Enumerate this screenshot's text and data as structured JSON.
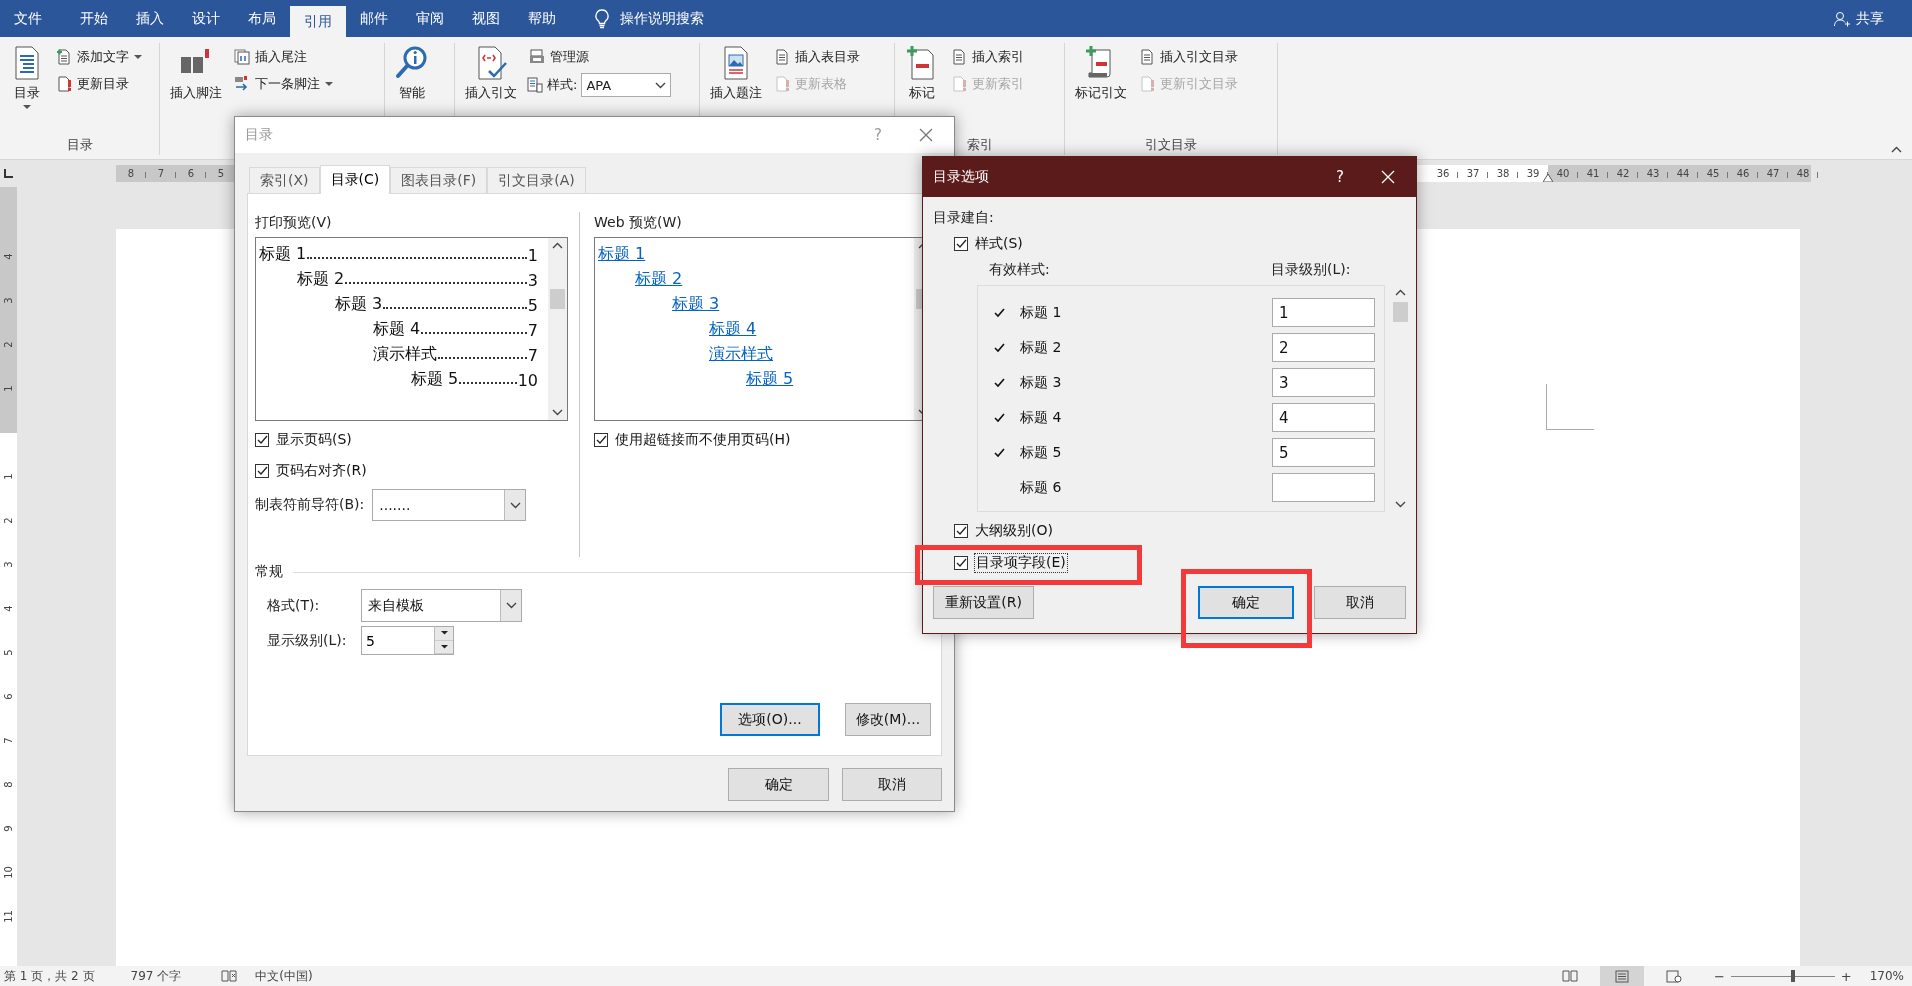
{
  "menu_tabs": [
    {
      "label": "文件",
      "selected": false
    },
    {
      "label": "开始",
      "selected": false
    },
    {
      "label": "插入",
      "selected": false
    },
    {
      "label": "设计",
      "selected": false
    },
    {
      "label": "布局",
      "selected": false
    },
    {
      "label": "引用",
      "selected": true
    },
    {
      "label": "邮件",
      "selected": false
    },
    {
      "label": "审阅",
      "selected": false
    },
    {
      "label": "视图",
      "selected": false
    },
    {
      "label": "帮助",
      "selected": false
    }
  ],
  "tell_me": "操作说明搜索",
  "share": "共享",
  "ribbon_groups": [
    {
      "label": "目录",
      "large": [
        {
          "label": "目录",
          "dropdown": true
        }
      ],
      "small": [
        {
          "kind": "button",
          "label": "添加文字",
          "dropdown": true,
          "disabled": false
        },
        {
          "kind": "button",
          "label": "更新目录",
          "dropdown": false,
          "disabled": false
        }
      ]
    },
    {
      "large": [
        {
          "label": "插入脚注",
          "dropdown": false
        }
      ],
      "small": [
        {
          "kind": "button",
          "label": "插入尾注",
          "dropdown": false,
          "disabled": false
        },
        {
          "kind": "button",
          "label": "下一条脚注",
          "dropdown": true,
          "disabled": false
        }
      ]
    },
    {
      "large": [
        {
          "label": "智能",
          "dropdown": false
        }
      ]
    },
    {
      "large": [
        {
          "label": "插入引文",
          "dropdown": false
        }
      ],
      "small": [
        {
          "kind": "button",
          "label": "管理源",
          "dropdown": false,
          "disabled": false
        },
        {
          "kind": "select",
          "label": "样式:",
          "value": "APA"
        }
      ]
    },
    {
      "large": [
        {
          "label": "插入题注",
          "dropdown": false
        }
      ],
      "small": [
        {
          "kind": "button",
          "label": "插入表目录",
          "dropdown": false,
          "disabled": false
        },
        {
          "kind": "button",
          "label": "更新表格",
          "dropdown": false,
          "disabled": true
        }
      ]
    },
    {
      "label": "索引",
      "large": [
        {
          "label": "标记",
          "dropdown": false
        }
      ],
      "small": [
        {
          "kind": "button",
          "label": "插入索引",
          "dropdown": false,
          "disabled": false
        },
        {
          "kind": "button",
          "label": "更新索引",
          "dropdown": false,
          "disabled": true
        }
      ]
    },
    {
      "label": "引文目录",
      "large": [
        {
          "label": "标记引文",
          "dropdown": false
        }
      ],
      "small": [
        {
          "kind": "button",
          "label": "插入引文目录",
          "dropdown": false,
          "disabled": false
        },
        {
          "kind": "button",
          "label": "更新引文目录",
          "dropdown": false,
          "disabled": true
        }
      ]
    }
  ],
  "ruler": {
    "left_numbers": [
      "8",
      "7",
      "6",
      "5"
    ],
    "right_numbers": [
      "36",
      "37",
      "38",
      "39",
      "40",
      "41",
      "42",
      "43",
      "44",
      "45",
      "46",
      "47",
      "48"
    ]
  },
  "vertical_ruler": {
    "top_numbers": [
      "4",
      "3",
      "2",
      "1"
    ],
    "bottom_numbers": [
      "1",
      "2",
      "3",
      "4",
      "5",
      "6",
      "7",
      "8",
      "9",
      "10",
      "11"
    ]
  },
  "toc_dialog": {
    "title": "目录",
    "help": "?",
    "tabs": [
      {
        "label": "索引(X)",
        "selected": false
      },
      {
        "label": "目录(C)",
        "selected": true
      },
      {
        "label": "图表目录(F)",
        "selected": false
      },
      {
        "label": "引文目录(A)",
        "selected": false
      }
    ],
    "print_preview": {
      "label": "打印预览(V)",
      "entries": [
        {
          "text": "标题 1",
          "page": "1",
          "children": [
            {
              "text": "标题 2",
              "page": "3",
              "children": [
                {
                  "text": "标题 3",
                  "page": "5",
                  "children": [
                    {
                      "text": "标题 4",
                      "page": "7"
                    },
                    {
                      "text": "演示样式",
                      "page": "7",
                      "children": [
                        {
                          "text": "标题 5",
                          "page": "10"
                        }
                      ]
                    }
                  ]
                }
              ]
            }
          ]
        }
      ]
    },
    "web_preview": {
      "label": "Web 预览(W)",
      "entries": [
        {
          "text": "标题 1",
          "children": [
            {
              "text": "标题 2",
              "children": [
                {
                  "text": "标题 3",
                  "children": [
                    {
                      "text": "标题 4"
                    },
                    {
                      "text": "演示样式",
                      "children": [
                        {
                          "text": "标题 5"
                        }
                      ]
                    }
                  ]
                }
              ]
            }
          ]
        }
      ]
    },
    "show_page_numbers": {
      "label": "显示页码(S)",
      "checked": true
    },
    "right_align": {
      "label": "页码右对齐(R)",
      "checked": true
    },
    "tab_leader": {
      "label": "制表符前导符(B):",
      "value": "......."
    },
    "use_hyperlinks": {
      "label": "使用超链接而不使用页码(H)",
      "checked": true
    },
    "general": {
      "label": "常规",
      "format_label": "格式(T):",
      "format_value": "来自模板",
      "levels_label": "显示级别(L):",
      "levels_value": "5"
    },
    "options_button": {
      "label": "选项(O)...",
      "focused": true
    },
    "modify_button": {
      "label": "修改(M)...",
      "focused": false
    },
    "ok": "确定",
    "cancel": "取消"
  },
  "options_dialog": {
    "title": "目录选项",
    "help": "?",
    "build_from": "目录建自:",
    "styles": {
      "label": "样式(S)",
      "checked": true
    },
    "style_header": "有效样式:",
    "level_header": "目录级别(L):",
    "rows": [
      {
        "name": "标题 1",
        "checked": true,
        "toc_level": "1"
      },
      {
        "name": "标题 2",
        "checked": true,
        "toc_level": "2"
      },
      {
        "name": "标题 3",
        "checked": true,
        "toc_level": "3"
      },
      {
        "name": "标题 4",
        "checked": true,
        "toc_level": "4"
      },
      {
        "name": "标题 5",
        "checked": true,
        "toc_level": "5"
      },
      {
        "name": "标题 6",
        "checked": false
      }
    ],
    "outline_levels": {
      "label": "大纲级别(O)",
      "checked": true,
      "focused": false
    },
    "entry_fields": {
      "label": "目录项字段(E)",
      "checked": true,
      "focused": true,
      "highlighted": true
    },
    "reset": "重新设置(R)",
    "ok": {
      "label": "确定",
      "focused": true,
      "highlighted": true
    },
    "cancel": "取消"
  },
  "status_bar": {
    "page": "第 1 页，共 2 页",
    "words": "797 个字",
    "language": "中文(中国)",
    "views": [
      {
        "selected": false
      },
      {
        "selected": true
      },
      {
        "selected": false
      }
    ],
    "zoom_out": "−",
    "zoom_in": "+",
    "zoom": {
      "level": 0.6
    },
    "zoom_label": "170%"
  }
}
